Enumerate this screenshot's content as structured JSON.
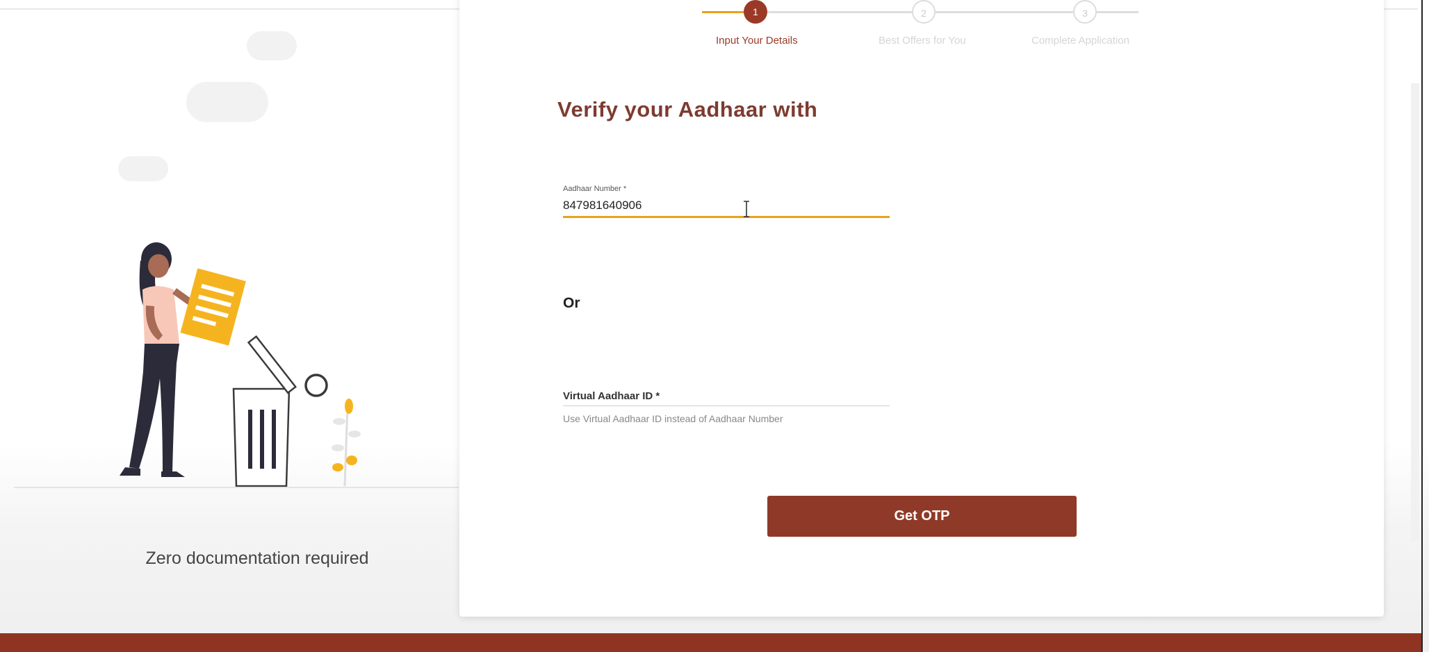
{
  "colors": {
    "brand": "#8f3a28",
    "heading": "#7e3b31",
    "accent": "#e8a21b",
    "footer": "#8f3322"
  },
  "stepper": {
    "steps": [
      {
        "number": "1",
        "label": "Input Your Details",
        "state": "active"
      },
      {
        "number": "2",
        "label": "Best Offers for You",
        "state": "pending"
      },
      {
        "number": "3",
        "label": "Complete Application",
        "state": "pending"
      }
    ]
  },
  "left_panel": {
    "caption": "Zero documentation required",
    "illustration_icon": "woman-discarding-documents-icon"
  },
  "form": {
    "heading": "Verify your Aadhaar with",
    "aadhaar": {
      "label": "Aadhaar Number *",
      "value": "847981640906"
    },
    "or_text": "Or",
    "virtual_id": {
      "label": "Virtual Aadhaar ID *",
      "help": "Use Virtual Aadhaar ID instead of Aadhaar Number"
    },
    "submit_label": "Get OTP"
  }
}
